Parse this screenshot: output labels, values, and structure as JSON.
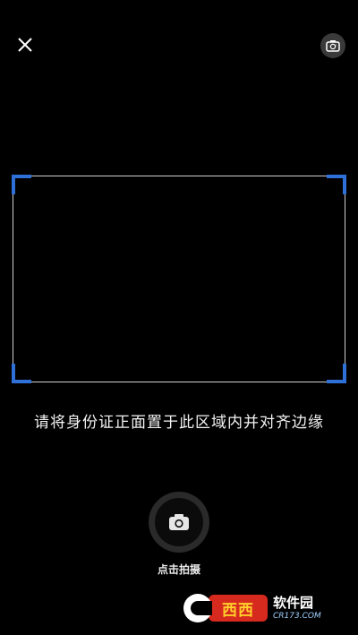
{
  "top_bar": {
    "close_icon": "close-icon",
    "flip_icon": "camera-flip-icon"
  },
  "scan": {
    "frame_color": "#cfcfcf",
    "corner_color": "#2f6fd8",
    "hint": "请将身份证正面置于此区域内并对齐边缘"
  },
  "capture": {
    "icon": "camera-icon",
    "label": "点击拍摄"
  },
  "watermark": {
    "mark": "西西",
    "brand": "软件园",
    "domain": "CR173.COM"
  }
}
